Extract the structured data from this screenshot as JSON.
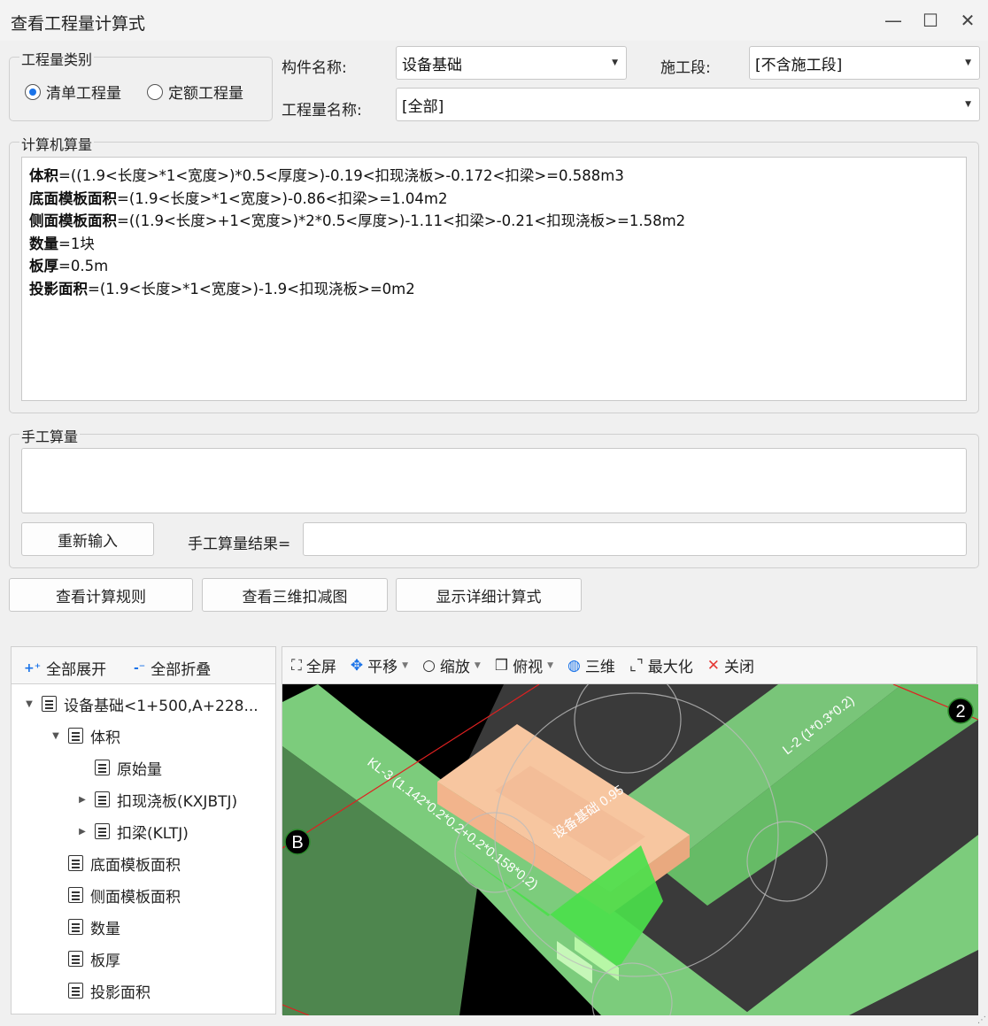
{
  "window": {
    "title": "查看工程量计算式",
    "minimize": "—",
    "maximize": "☐",
    "close": "✕"
  },
  "qtyType": {
    "legend": "工程量类别",
    "options": [
      "清单工程量",
      "定额工程量"
    ],
    "selected": "清单工程量"
  },
  "fields": {
    "component_label": "构件名称:",
    "component_value": "设备基础",
    "stage_label": "施工段:",
    "stage_value": "[不含施工段]",
    "qtyname_label": "工程量名称:",
    "qtyname_value": "[全部]"
  },
  "computed": {
    "legend": "计算机算量",
    "lines": [
      {
        "name": "体积",
        "expr": "=((1.9<长度>*1<宽度>)*0.5<厚度>)-0.19<扣现浇板>-0.172<扣梁>=0.588m3"
      },
      {
        "name": "底面模板面积",
        "expr": "=(1.9<长度>*1<宽度>)-0.86<扣梁>=1.04m2"
      },
      {
        "name": "侧面模板面积",
        "expr": "=((1.9<长度>+1<宽度>)*2*0.5<厚度>)-1.11<扣梁>-0.21<扣现浇板>=1.58m2"
      },
      {
        "name": "数量",
        "expr": "=1块"
      },
      {
        "name": "板厚",
        "expr": "=0.5m"
      },
      {
        "name": "投影面积",
        "expr": "=(1.9<长度>*1<宽度>)-1.9<扣现浇板>=0m2"
      }
    ]
  },
  "manual": {
    "legend": "手工算量",
    "reenter": "重新输入",
    "result_label": "手工算量结果=",
    "result_value": ""
  },
  "actions": {
    "rules": "查看计算规则",
    "view3d": "查看三维扣减图",
    "detail": "显示详细计算式"
  },
  "tree": {
    "expand_all": "全部展开",
    "collapse_all": "全部折叠",
    "nodes": [
      {
        "label": "设备基础<1+500,A+228...",
        "state": "expanded"
      },
      {
        "label": "体积",
        "state": "expanded"
      },
      {
        "label": "原始量",
        "state": "leaf"
      },
      {
        "label": "扣现浇板(KXJBTJ)",
        "state": "collapsed"
      },
      {
        "label": "扣梁(KLTJ)",
        "state": "collapsed"
      },
      {
        "label": "底面模板面积",
        "state": "leaf"
      },
      {
        "label": "侧面模板面积",
        "state": "leaf"
      },
      {
        "label": "数量",
        "state": "leaf"
      },
      {
        "label": "板厚",
        "state": "leaf"
      },
      {
        "label": "投影面积",
        "state": "leaf"
      }
    ]
  },
  "viewer": {
    "toolbar": {
      "fullscreen": "全屏",
      "pan": "平移",
      "zoom": "缩放",
      "topview": "俯视",
      "threed": "三维",
      "maximize": "最大化",
      "close": "关闭"
    },
    "scene_labels": {
      "beam_kl3": "KL-3 (1.142*0.2*0.2+0.2*0.158*0.2)",
      "beam_l2": "L-2 (1*0.3*0.2)",
      "foundation": "设备基础 0.95",
      "axis_b": "B",
      "axis_2": "2"
    },
    "colors": {
      "beam_green": "#7ccc7c",
      "bright_green": "#4be04b",
      "foundation": "#f7c6a0",
      "slab": "#3a3a3a",
      "background": "#000000"
    }
  }
}
